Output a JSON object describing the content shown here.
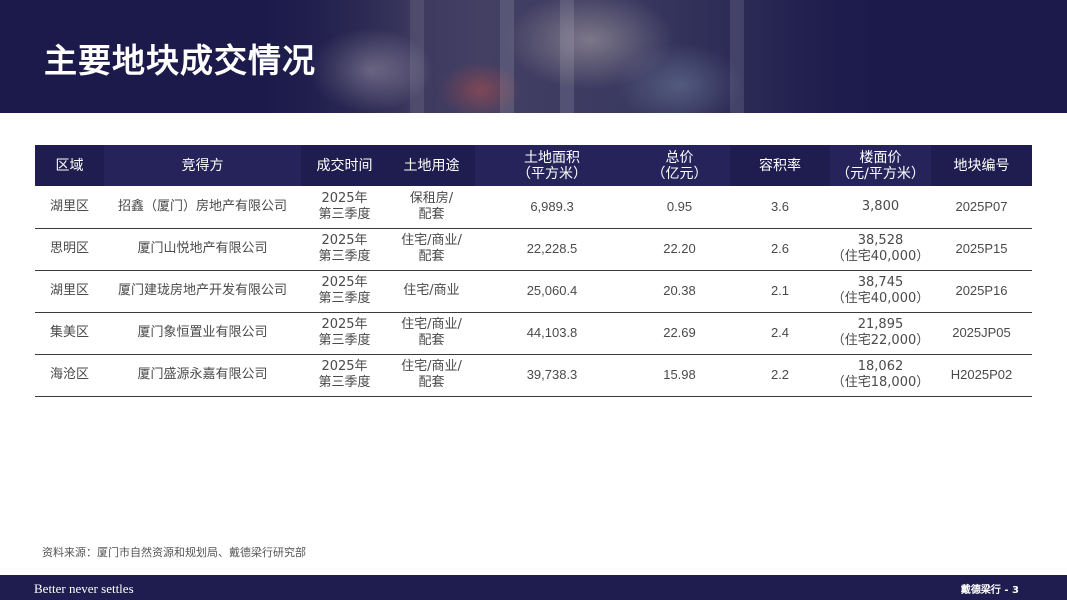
{
  "header": {
    "title": "主要地块成交情况"
  },
  "table": {
    "columns": [
      "区域",
      "竞得方",
      "成交时间",
      "土地用途",
      "土地面积\n（平方米）",
      "总价\n（亿元）",
      "容积率",
      "楼面价\n（元/平方米）",
      "地块编号"
    ],
    "rows": [
      [
        "湖里区",
        "招鑫（厦门）房地产有限公司",
        "2025年\n第三季度",
        "保租房/\n配套",
        "6,989.3",
        "0.95",
        "3.6",
        "3,800",
        "2025P07"
      ],
      [
        "思明区",
        "厦门山悦地产有限公司",
        "2025年\n第三季度",
        "住宅/商业/\n配套",
        "22,228.5",
        "22.20",
        "2.6",
        "38,528\n（住宅40,000）",
        "2025P15"
      ],
      [
        "湖里区",
        "厦门建珑房地产开发有限公司",
        "2025年\n第三季度",
        "住宅/商业",
        "25,060.4",
        "20.38",
        "2.1",
        "38,745\n（住宅40,000）",
        "2025P16"
      ],
      [
        "集美区",
        "厦门象恒置业有限公司",
        "2025年\n第三季度",
        "住宅/商业/\n配套",
        "44,103.8",
        "22.69",
        "2.4",
        "21,895\n（住宅22,000）",
        "2025JP05"
      ],
      [
        "海沧区",
        "厦门盛源永嘉有限公司",
        "2025年\n第三季度",
        "住宅/商业/\n配套",
        "39,738.3",
        "15.98",
        "2.2",
        "18,062\n（住宅18,000）",
        "H2025P02"
      ]
    ]
  },
  "source": "资料来源：厦门市自然资源和规划局、戴德梁行研究部",
  "footer": {
    "slogan": "Better never settles",
    "page_label": "戴德梁行 - 3"
  }
}
